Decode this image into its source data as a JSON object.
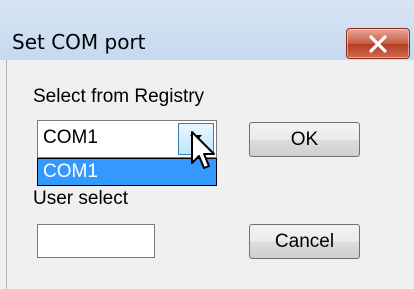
{
  "dialog": {
    "title": "Set COM port",
    "close_icon": "close-x-icon",
    "close_color": "#c75d44"
  },
  "registry": {
    "label": "Select from Registry",
    "selected_value": "COM1",
    "dropdown_icon": "dropdown-arrow-icon",
    "options": [
      "COM1"
    ],
    "highlight_color": "#3399ff"
  },
  "user_select": {
    "label": "User select",
    "value": ""
  },
  "buttons": {
    "ok_label": "OK",
    "cancel_label": "Cancel"
  },
  "cursor_icon": "mouse-pointer-icon"
}
